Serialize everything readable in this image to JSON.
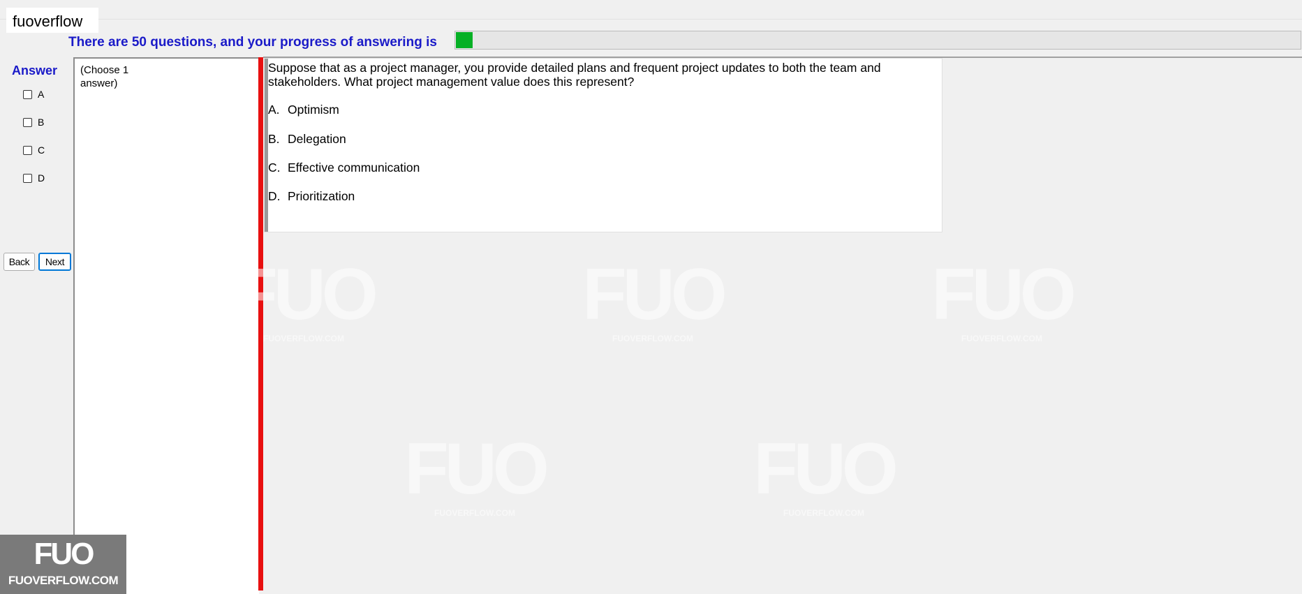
{
  "app": {
    "title": "fuoverflow"
  },
  "progress": {
    "label": "There are 50 questions, and your progress of answering is",
    "value_fraction": 0.02,
    "fill_color": "#06b025"
  },
  "answer": {
    "heading": "Answer",
    "options": [
      "A",
      "B",
      "C",
      "D"
    ]
  },
  "navigation": {
    "back_label": "Back",
    "next_label": "Next"
  },
  "instruction": {
    "text": "(Choose 1 answer)"
  },
  "question": {
    "text": "Suppose that as a project manager, you provide detailed plans and frequent project updates to both the team and stakeholders. What project management value does this represent?",
    "options": [
      {
        "letter": "A.",
        "text": "Optimism"
      },
      {
        "letter": "B.",
        "text": "Delegation"
      },
      {
        "letter": "C.",
        "text": "Effective communication"
      },
      {
        "letter": "D.",
        "text": "Prioritization"
      }
    ]
  },
  "watermark": {
    "big": "FUO",
    "small": "FUOVERFLOW.COM"
  },
  "logo": {
    "big": "FUO",
    "small": "FUOVERFLOW.COM"
  },
  "colors": {
    "accent_blue": "#1a1ac8",
    "divider_red": "#e81010"
  }
}
